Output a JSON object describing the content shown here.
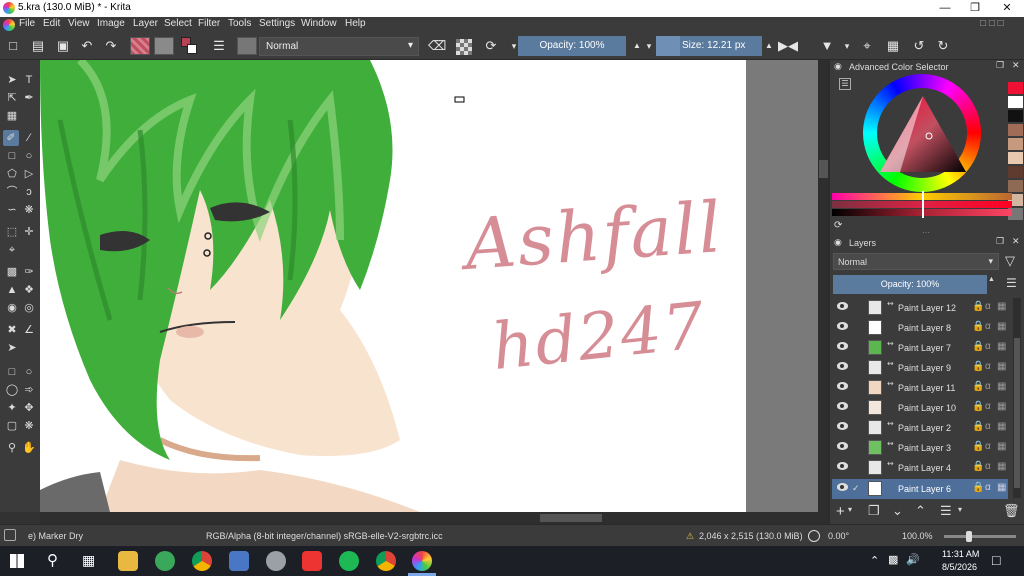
{
  "window": {
    "title": "5.kra (130.0 MiB) * - Krita"
  },
  "menu": [
    "File",
    "Edit",
    "View",
    "Image",
    "Layer",
    "Select",
    "Filter",
    "Tools",
    "Settings",
    "Window",
    "Help"
  ],
  "toolbar": {
    "blend_mode": "Normal",
    "opacity": "Opacity: 100%",
    "size": "Size: 12.21 px"
  },
  "canvas": {
    "text_line1": "Ashfall",
    "text_line2": "hd247"
  },
  "color_selector": {
    "title": "Advanced Color Selector",
    "accent": "#b94055"
  },
  "layers": {
    "title": "Layers",
    "blend_mode": "Normal",
    "opacity": "Opacity: 100%",
    "items": [
      {
        "name": "Paint Layer 12"
      },
      {
        "name": "Paint Layer 8"
      },
      {
        "name": "Paint Layer 7"
      },
      {
        "name": "Paint Layer 9"
      },
      {
        "name": "Paint Layer 11"
      },
      {
        "name": "Paint Layer 10"
      },
      {
        "name": "Paint Layer 2"
      },
      {
        "name": "Paint Layer 3"
      },
      {
        "name": "Paint Layer 4"
      },
      {
        "name": "Paint Layer 6"
      }
    ]
  },
  "status": {
    "brush": "e) Marker Dry",
    "colorspace": "RGB/Alpha (8-bit integer/channel)  sRGB-elle-V2-srgbtrc.icc",
    "dimensions": "2,046 x 2,515 (130.0 MiB)",
    "rotation": "0.00°",
    "zoom": "100.0%"
  },
  "taskbar": {
    "time": "11:31 AM",
    "date": "8/5/2026"
  }
}
